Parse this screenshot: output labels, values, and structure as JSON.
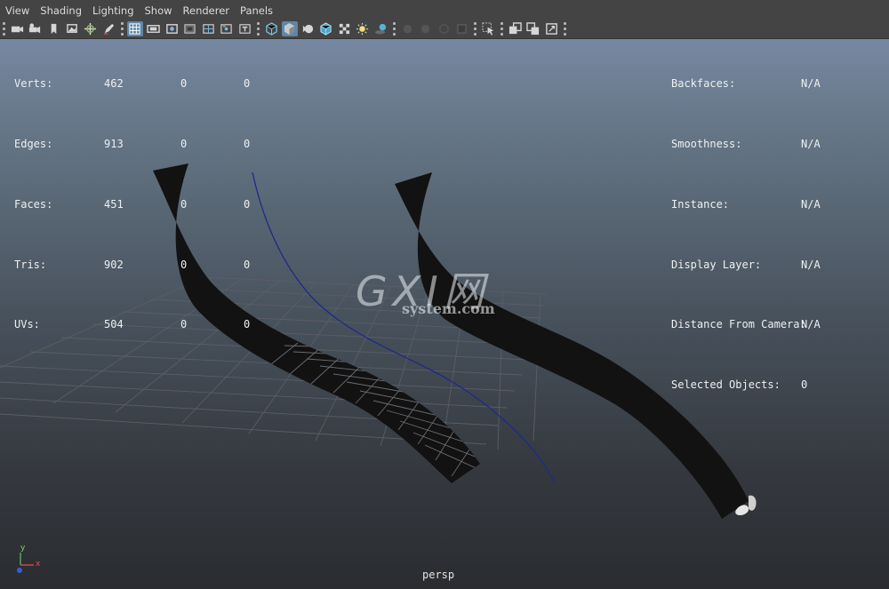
{
  "menu": [
    "View",
    "Shading",
    "Lighting",
    "Show",
    "Renderer",
    "Panels"
  ],
  "toolbar_icons": [
    "camera-icon",
    "camera-attributes-icon",
    "bookmark-icon",
    "image-plane-icon",
    "2d-pan-zoom-icon",
    "grease-pencil-icon",
    "grid-icon",
    "film-gate-icon",
    "resolution-gate-icon",
    "gate-mask-icon",
    "field-chart-icon",
    "safe-action-icon",
    "safe-title-icon",
    "wireframe-icon",
    "smooth-shade-icon",
    "default-material-icon",
    "wireframe-on-shaded-icon",
    "textured-icon",
    "use-all-lights-icon",
    "shadows-icon",
    "screen-space-ao-icon",
    "motion-blur-icon",
    "multisample-aa-icon",
    "depth-of-field-icon",
    "isolate-select-icon",
    "xray-icon",
    "xray-joints-icon",
    "xray-components-icon"
  ],
  "stats_left": [
    {
      "label": "Verts:",
      "values": [
        "462",
        "0",
        "0"
      ]
    },
    {
      "label": "Edges:",
      "values": [
        "913",
        "0",
        "0"
      ]
    },
    {
      "label": "Faces:",
      "values": [
        "451",
        "0",
        "0"
      ]
    },
    {
      "label": "Tris:",
      "values": [
        "902",
        "0",
        "0"
      ]
    },
    {
      "label": "UVs:",
      "values": [
        "504",
        "0",
        "0"
      ]
    }
  ],
  "stats_right": [
    {
      "label": "Backfaces:",
      "value": "N/A"
    },
    {
      "label": "Smoothness:",
      "value": "N/A"
    },
    {
      "label": "Instance:",
      "value": "N/A"
    },
    {
      "label": "Display Layer:",
      "value": "N/A"
    },
    {
      "label": "Distance From Camera:",
      "value": "N/A"
    },
    {
      "label": "Selected Objects:",
      "value": "0"
    }
  ],
  "watermark": {
    "big": "GXI网",
    "small": "system.com"
  },
  "axis": {
    "y": "y",
    "x": "x"
  },
  "camera_label": "persp",
  "colors": {
    "panel_bg": "#444444",
    "menu_text": "#dcdcdc",
    "active_toggle": "#5d87a8",
    "viewport_top": "#7688a1",
    "viewport_bottom": "#2a2c30",
    "mesh": "#111111",
    "curve": "#1d2a8a",
    "grid": "#5a5a5a"
  }
}
